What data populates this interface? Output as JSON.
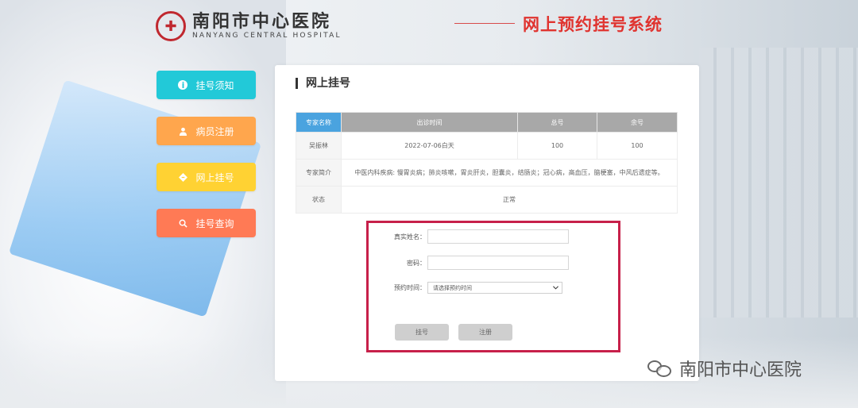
{
  "header": {
    "hospital_cn": "南阳市中心医院",
    "hospital_en": "NANYANG CENTRAL HOSPITAL",
    "system_title": "网上预约挂号系统"
  },
  "nav": {
    "items": [
      {
        "label": "挂号须知",
        "icon": "info-icon",
        "color": "#22c9d8"
      },
      {
        "label": "病员注册",
        "icon": "user-icon",
        "color": "#ffa64d"
      },
      {
        "label": "网上挂号",
        "icon": "diamond-icon",
        "color": "#ffd233"
      },
      {
        "label": "挂号查询",
        "icon": "search-icon",
        "color": "#ff7a55"
      }
    ]
  },
  "panel": {
    "title": "网上挂号",
    "table": {
      "headers": [
        "专家名称",
        "出诊时间",
        "总号",
        "余号"
      ],
      "row": {
        "name": "吴振林",
        "time": "2022-07-06白天",
        "total": "100",
        "remaining": "100"
      },
      "intro_label": "专家简介",
      "intro": "中医内科疾病: 慢胃炎病；肺炎咳嗽，胃炎肝炎，胆囊炎，结肠炎；冠心病，高血压，脑梗塞，中风后遗症等。",
      "status_label": "状态",
      "status": "正常"
    },
    "form": {
      "name_label": "真实姓名：",
      "name_value": "",
      "password_label": "密码：",
      "password_value": "",
      "time_label": "预约时间：",
      "time_placeholder": "请选择预约时间",
      "submit_label": "挂号",
      "register_label": "注册"
    }
  },
  "watermark": {
    "text": "南阳市中心医院"
  },
  "colors": {
    "accent_red": "#e0332f",
    "form_border": "#c7204a",
    "header_blue": "#4aa3df"
  }
}
